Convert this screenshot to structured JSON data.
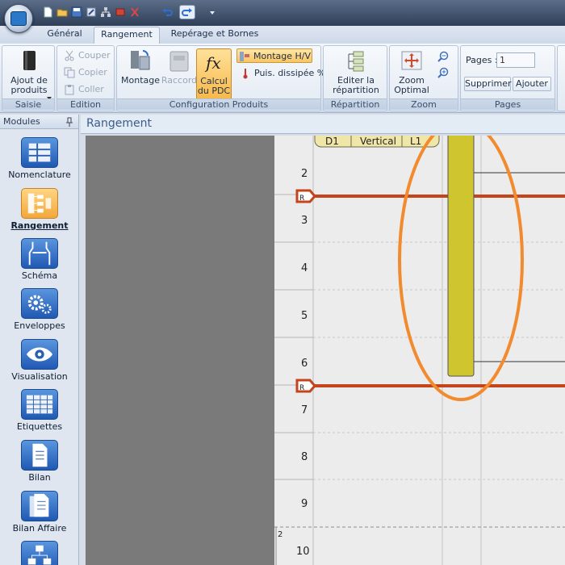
{
  "quick_access": {
    "icons": [
      "new-doc-icon",
      "open-folder-icon",
      "save-icon",
      "edit-icon",
      "network-icon",
      "cut-icon",
      "undo-icon",
      "redo-icon",
      "dropdown-arrow-icon"
    ]
  },
  "tabs": [
    {
      "label": "Général",
      "active": false
    },
    {
      "label": "Rangement",
      "active": true
    },
    {
      "label": "Repérage et Bornes",
      "active": false
    }
  ],
  "ribbon": {
    "saisie": {
      "label": "Saisie",
      "ajout_label": "Ajout de\nproduits"
    },
    "edition": {
      "label": "Edition",
      "couper": "Couper",
      "copier": "Copier",
      "coller": "Coller"
    },
    "config": {
      "label": "Configuration Produits",
      "montage": "Montage",
      "raccord": "Raccord",
      "calcul": "Calcul\ndu PDC",
      "montage_hv": "Montage H/V",
      "puis": "Puis. dissipée %"
    },
    "repartition": {
      "label": "Répartition",
      "editer": "Editer la\nrépartition"
    },
    "zoom": {
      "label": "Zoom",
      "zoom_optimal": "Zoom\nOptimal"
    },
    "pages": {
      "label": "Pages",
      "pages_label": "Pages :",
      "pages_value": "1",
      "supprimer": "Supprimer",
      "ajouter": "Ajouter"
    }
  },
  "modules": {
    "header": "Modules",
    "items": [
      {
        "label": "Nomenclature",
        "active": false
      },
      {
        "label": "Rangement",
        "active": true
      },
      {
        "label": "Schéma",
        "active": false
      },
      {
        "label": "Enveloppes",
        "active": false
      },
      {
        "label": "Visualisation",
        "active": false
      },
      {
        "label": "Etiquettes",
        "active": false
      },
      {
        "label": "Bilan",
        "active": false
      },
      {
        "label": "Bilan Affaire",
        "active": false
      }
    ]
  },
  "document": {
    "title": "Rangement",
    "rail_header": [
      "D1",
      "Vertical",
      "L1"
    ],
    "row_numbers": [
      "2",
      "3",
      "4",
      "5",
      "6",
      "7",
      "8",
      "9",
      "10"
    ],
    "page_marker": "2",
    "rail_marker_letter": "R",
    "colors": {
      "rail": "#c4441c",
      "component": "#cfc52e",
      "highlight": "#f28a2e"
    }
  }
}
